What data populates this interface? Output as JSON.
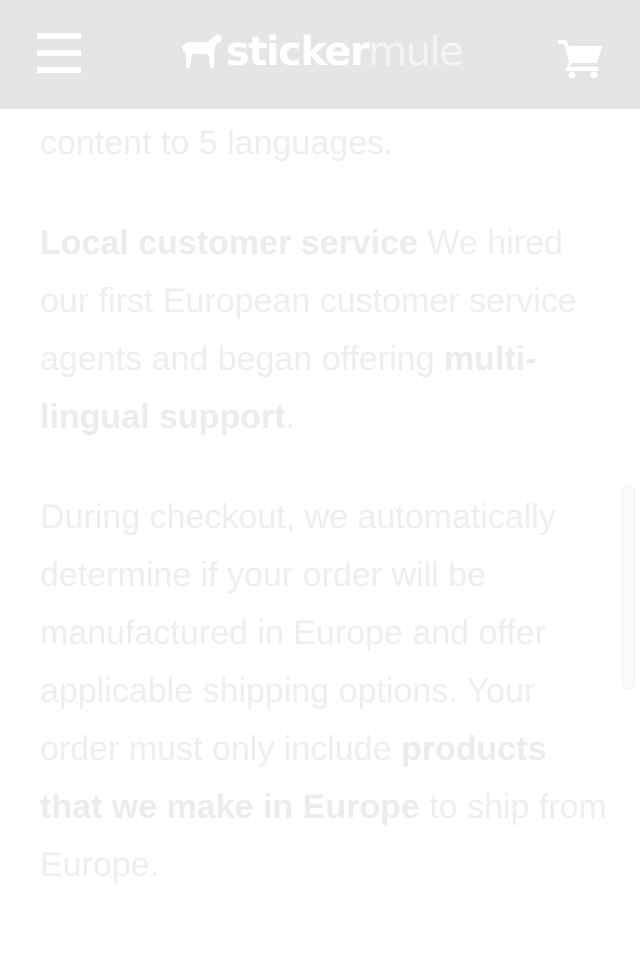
{
  "header": {
    "logo_sticker": "sticker",
    "logo_mule": "mule",
    "icons": {
      "menu": "hamburger-menu-icon",
      "cart": "shopping-cart-icon",
      "logo": "mule-logo-icon"
    }
  },
  "content": {
    "p0": "content to 5 languages.",
    "p1_bold1": "Local customer service",
    "p1_text1": " We hired our first European customer service agents and began offering ",
    "p1_bold2": "multi-lingual support",
    "p1_text2": ".",
    "p2_text1": "During checkout, we automatically determine if your order will be manufactured in Europe and offer applicable shipping options. Your order must only include ",
    "p2_bold1": "products that we make in Europe",
    "p2_text2": " to ship from Europe."
  },
  "colors": {
    "header_bg": "#e5e5e5",
    "text": "#eeeeee",
    "page_bg": "#ffffff"
  }
}
